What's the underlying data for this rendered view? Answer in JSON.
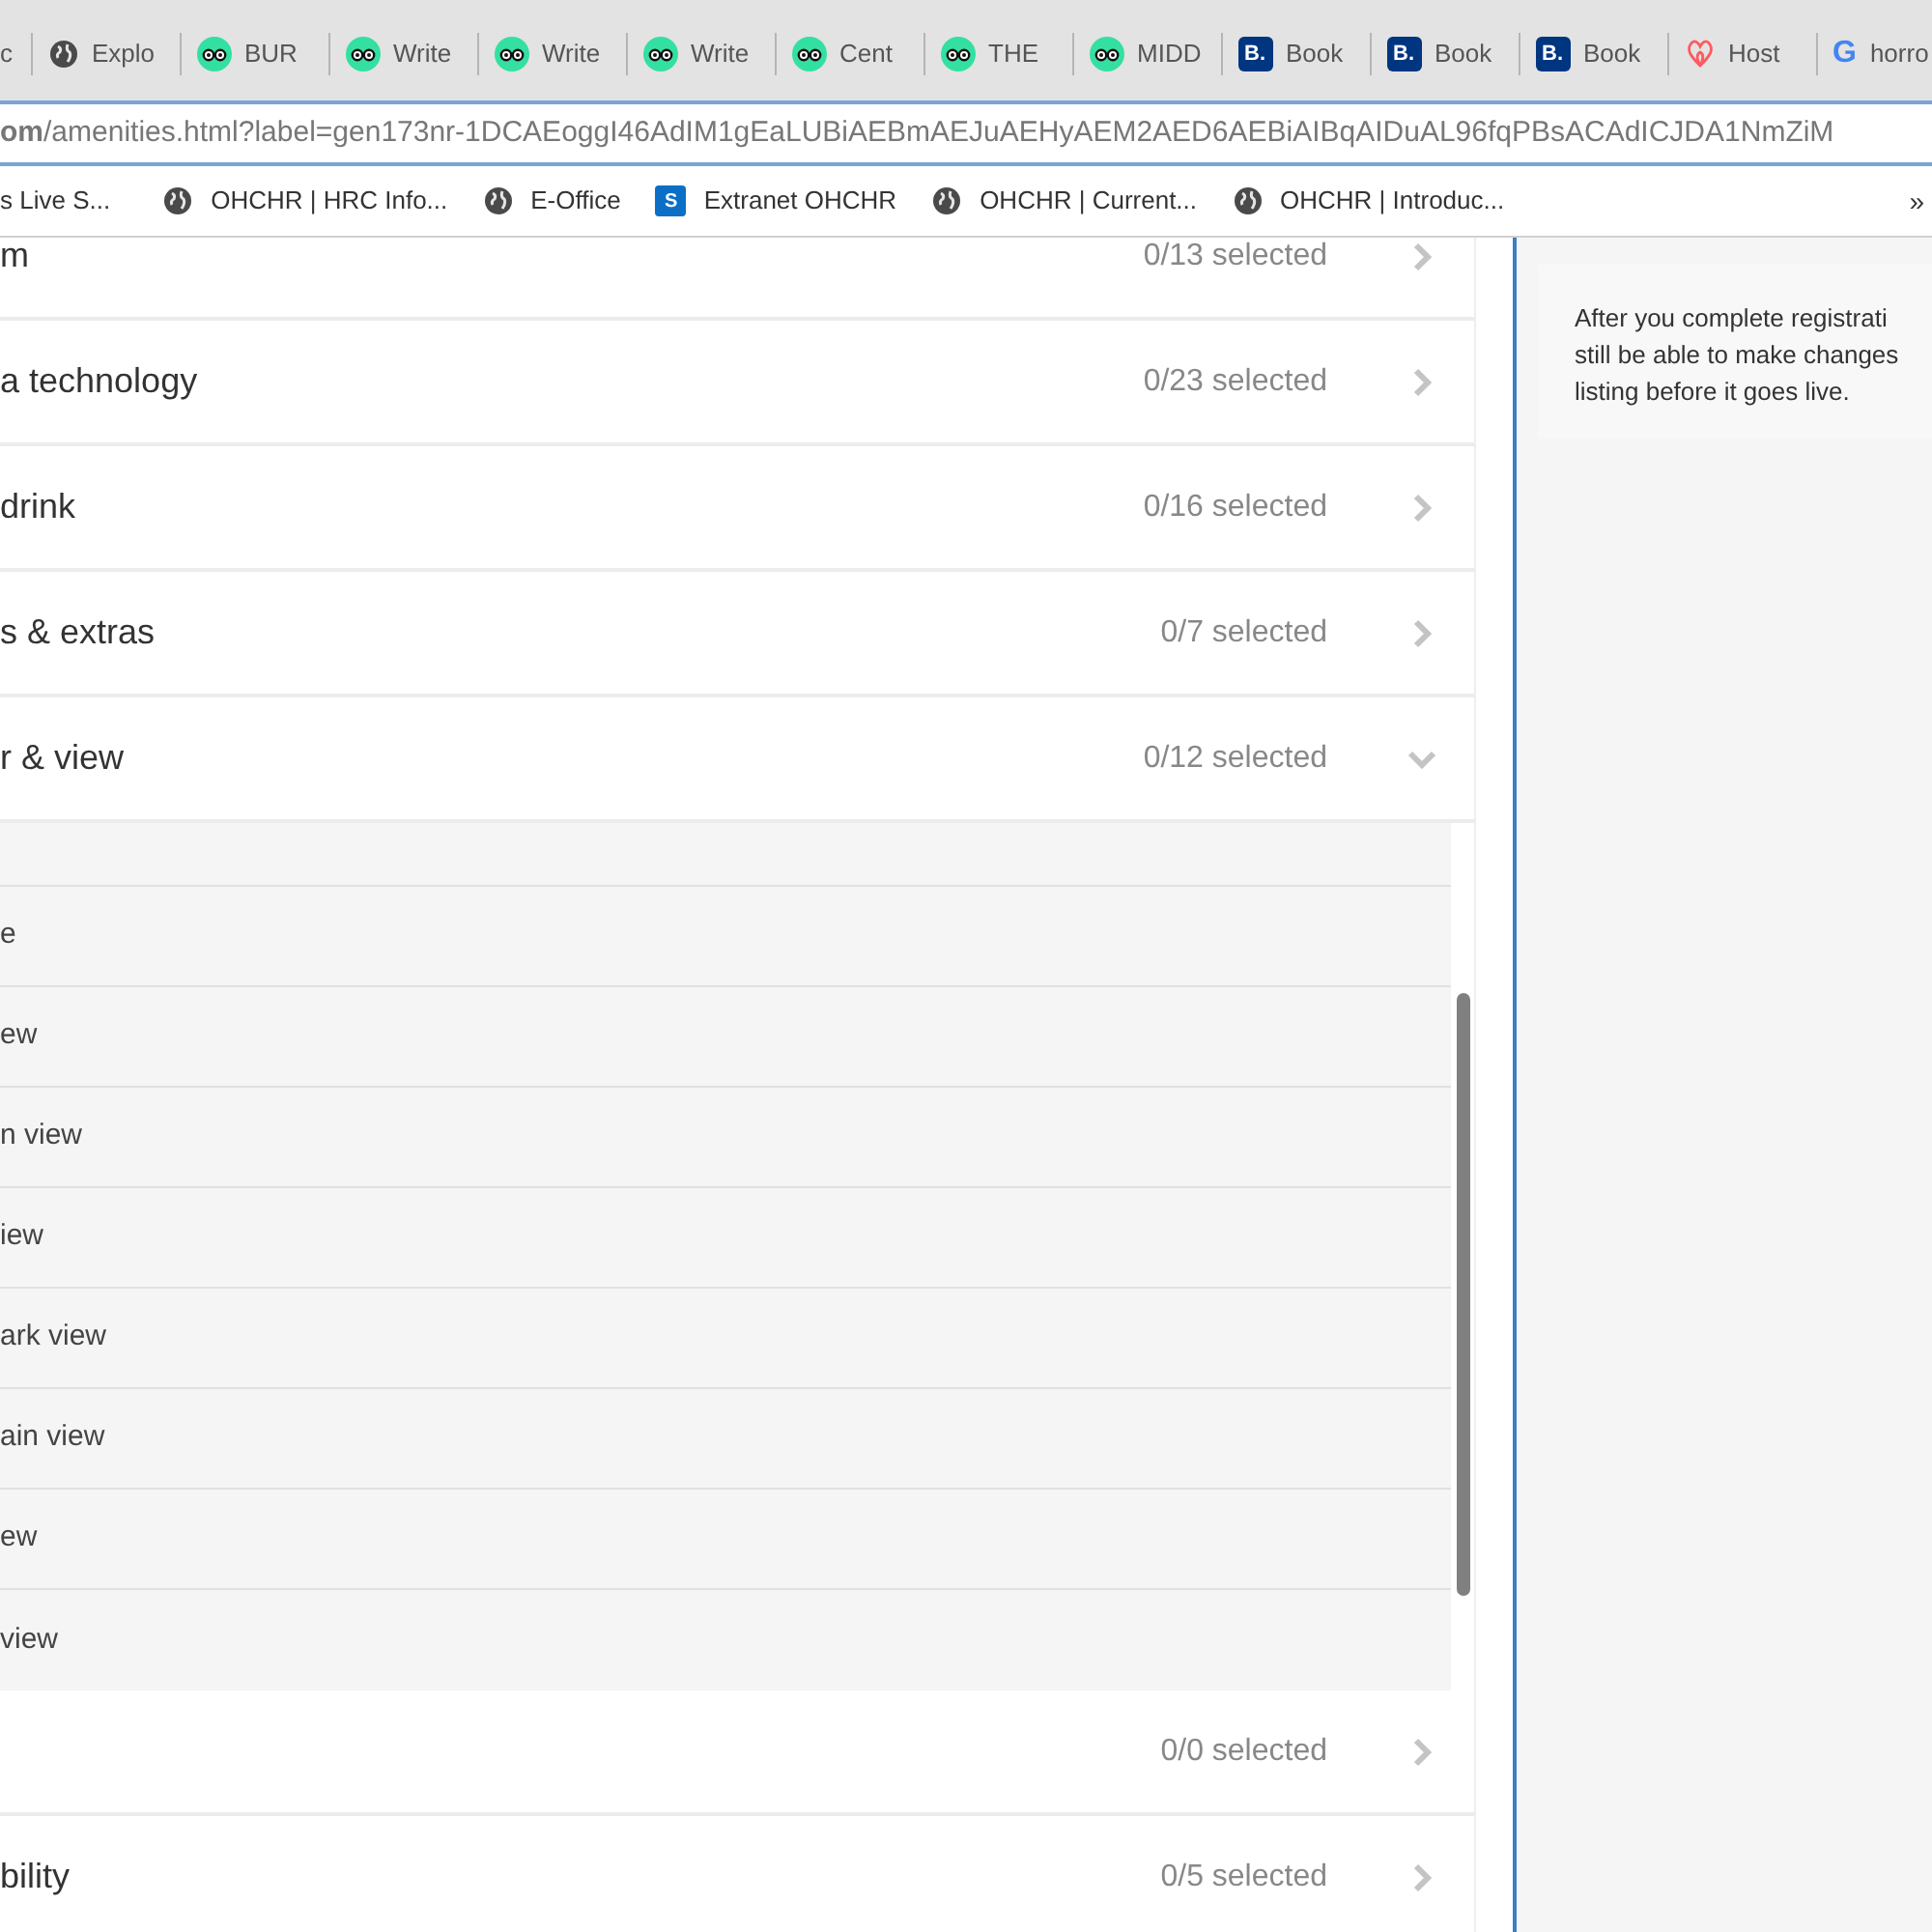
{
  "tabs": [
    {
      "kind": "none",
      "label": "c"
    },
    {
      "kind": "globe",
      "label": "Explo"
    },
    {
      "kind": "owl",
      "label": "BUR"
    },
    {
      "kind": "owl",
      "label": "Write"
    },
    {
      "kind": "owl",
      "label": "Write"
    },
    {
      "kind": "owl",
      "label": "Write"
    },
    {
      "kind": "owl",
      "label": "Cent"
    },
    {
      "kind": "owl",
      "label": "THE"
    },
    {
      "kind": "owl",
      "label": "MIDD"
    },
    {
      "kind": "booking",
      "label": "Book",
      "badge": "B."
    },
    {
      "kind": "booking",
      "label": "Book",
      "badge": "B."
    },
    {
      "kind": "booking",
      "label": "Book",
      "badge": "B."
    },
    {
      "kind": "airbnb",
      "label": "Host"
    },
    {
      "kind": "google",
      "label": "horro",
      "badge": "G"
    }
  ],
  "address_bar": {
    "url": "**om**/amenities.html?label=gen173nr-1DCAEoggI46AdIM1gEaLUBiAEBmAEJuAEHyAEM2AED6AEBiAIBqAIDuAL96fqPBsACAdICJDA1NmZiM"
  },
  "bookmarks": [
    {
      "kind": "none",
      "label": "s Live S..."
    },
    {
      "kind": "globe",
      "label": "OHCHR | HRC Info..."
    },
    {
      "kind": "globe",
      "label": "E-Office"
    },
    {
      "kind": "sharepoint",
      "label": "Extranet OHCHR",
      "badge": "S"
    },
    {
      "kind": "globe",
      "label": "OHCHR | Current..."
    },
    {
      "kind": "globe",
      "label": "OHCHR | Introduc..."
    }
  ],
  "bookmarks_overflow": "»",
  "sections": [
    {
      "title": "m",
      "count": "0/13 selected",
      "expanded": false
    },
    {
      "title": "a technology",
      "count": "0/23 selected",
      "expanded": false
    },
    {
      "title": "drink",
      "count": "0/16 selected",
      "expanded": false
    },
    {
      "title": "s & extras",
      "count": "0/7 selected",
      "expanded": false
    },
    {
      "title": "r & view",
      "count": "0/12 selected",
      "expanded": true,
      "items": [
        "e",
        "ew",
        "n view",
        "iew",
        "ark view",
        "ain view",
        "ew",
        "view"
      ]
    },
    {
      "count": "0/0 selected",
      "expanded": false
    },
    {
      "title": "bility",
      "count": "0/5 selected",
      "expanded": false
    }
  ],
  "info_card": {
    "lines": [
      "After you complete registrati",
      "still be able to make changes",
      "listing before it goes live."
    ]
  }
}
